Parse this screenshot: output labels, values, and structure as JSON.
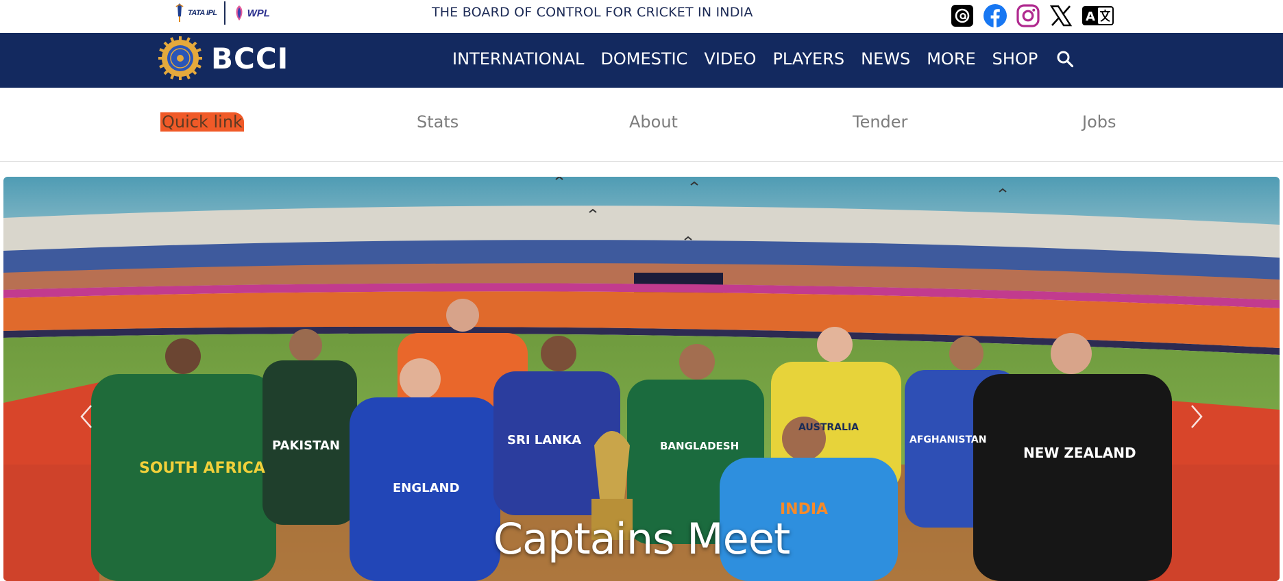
{
  "topbar": {
    "ipl_logo": "TATA IPL",
    "wpl_logo": "WPL",
    "title": "THE BOARD OF CONTROL FOR CRICKET IN INDIA",
    "social_icons": [
      "threads-icon",
      "facebook-icon",
      "instagram-icon",
      "x-icon",
      "translate-icon"
    ]
  },
  "navbar": {
    "brand": "BCCI",
    "items": [
      "INTERNATIONAL",
      "DOMESTIC",
      "VIDEO",
      "PLAYERS",
      "NEWS",
      "MORE",
      "SHOP"
    ],
    "search_icon": "search-icon"
  },
  "quickbar": {
    "label": "Quick link",
    "links": [
      "Stats",
      "About",
      "Tender",
      "Jobs"
    ]
  },
  "hero": {
    "caption": "Captains Meet",
    "prev_icon": "chevron-left-icon",
    "next_icon": "chevron-right-icon",
    "jersey_labels": [
      "SOUTH AFRICA",
      "PAKISTAN",
      "ENGLAND",
      "SRI LANKA",
      "BANGLADESH",
      "INDIA",
      "AUSTRALIA",
      "AFGHANISTAN",
      "NEW ZEALAND"
    ]
  },
  "colors": {
    "navy": "#13295f",
    "accent_orange": "#f05a28",
    "link_gray": "#7d7d7d"
  }
}
